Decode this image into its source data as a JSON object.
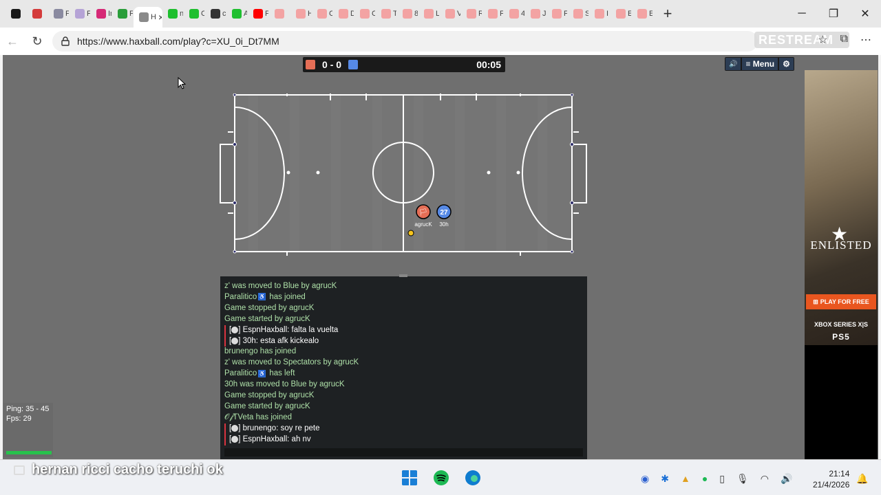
{
  "browser": {
    "tabs": [
      {
        "label": "",
        "color": "#1a1a1a"
      },
      {
        "label": "",
        "color": "#d43b3b"
      },
      {
        "label": "F",
        "color": "#8a8aa0"
      },
      {
        "label": "F",
        "color": "#b5a3d6"
      },
      {
        "label": "In",
        "color": "#d62976"
      },
      {
        "label": "F",
        "color": "#2a9d3a"
      },
      {
        "label": "n",
        "color": "#1fbf2f"
      },
      {
        "label": "C",
        "color": "#1fbf2f"
      },
      {
        "label": "c",
        "color": "#333333"
      },
      {
        "label": "A",
        "color": "#1fbf2f"
      },
      {
        "label": "P",
        "color": "#ff0000"
      },
      {
        "label": "",
        "color": "#f3a3a3"
      },
      {
        "label": "H",
        "color": "#f3a3a3"
      },
      {
        "label": "C",
        "color": "#f3a3a3"
      },
      {
        "label": "D",
        "color": "#f3a3a3"
      },
      {
        "label": "C",
        "color": "#f3a3a3"
      },
      {
        "label": "T",
        "color": "#f3a3a3"
      },
      {
        "label": "8",
        "color": "#f3a3a3"
      },
      {
        "label": "L",
        "color": "#f3a3a3"
      },
      {
        "label": "V",
        "color": "#f3a3a3"
      },
      {
        "label": "R",
        "color": "#f3a3a3"
      },
      {
        "label": "F",
        "color": "#f3a3a3"
      },
      {
        "label": "4",
        "color": "#f3a3a3"
      },
      {
        "label": "J",
        "color": "#f3a3a3"
      },
      {
        "label": "F",
        "color": "#f3a3a3"
      },
      {
        "label": "S",
        "color": "#f3a3a3"
      },
      {
        "label": "I",
        "color": "#f3a3a3"
      },
      {
        "label": "E",
        "color": "#f3a3a3"
      },
      {
        "label": "E",
        "color": "#f3a3a3"
      }
    ],
    "active_tab": {
      "label": "H",
      "close": "×"
    },
    "new_tab": "+",
    "window_controls": {
      "minimize": "─",
      "maximize": "❐",
      "close": "✕"
    },
    "back": "←",
    "reload": "↻",
    "url": "https://www.haxball.com/play?c=XU_0i_Dt7MM",
    "restream": "RESTREAM",
    "more": "⋯"
  },
  "game": {
    "score_red": "0",
    "score_sep": "-",
    "score_blue": "0",
    "time": "00:05",
    "red_color": "#e56e56",
    "blue_color": "#5689e5",
    "buttons": {
      "sound": "🔊",
      "menu": "≡ Menu",
      "settings": "⚙"
    },
    "players": [
      {
        "name": "agrucK",
        "avatar": "🏳",
        "team": "red"
      },
      {
        "name": "30h",
        "avatar": "27",
        "team": "blue"
      }
    ]
  },
  "chat": {
    "lines": [
      {
        "type": "notice",
        "text": "z' was moved to Blue by agrucK"
      },
      {
        "type": "notice",
        "text": "Paralitico",
        "badge": "♿",
        "suffix": "has joined"
      },
      {
        "type": "notice",
        "text": "Game stopped by agrucK"
      },
      {
        "type": "notice",
        "text": "Game started by agrucK"
      },
      {
        "type": "msg",
        "prefix": "[",
        "close": "] ",
        "text": "EspnHaxball: falta la vuelta"
      },
      {
        "type": "msg",
        "prefix": "[",
        "close": "] ",
        "text": "30h: esta afk kickealo"
      },
      {
        "type": "notice",
        "text": "brunengo has joined"
      },
      {
        "type": "notice",
        "text": "z' was moved to Spectators by agrucK"
      },
      {
        "type": "notice",
        "text": "Paralitico",
        "badge": "♿",
        "suffix": "has left"
      },
      {
        "type": "notice",
        "text": "30h was moved to Blue by agrucK"
      },
      {
        "type": "notice",
        "text": "Game stopped by agrucK"
      },
      {
        "type": "notice",
        "text": "Game started by agrucK"
      },
      {
        "type": "notice",
        "text": "𝒪𝒻TVeta has joined"
      },
      {
        "type": "msg",
        "prefix": "[",
        "close": "] ",
        "text": "brunengo: soy re pete"
      },
      {
        "type": "msg",
        "prefix": "[",
        "close": "] ",
        "text": "EspnHaxball: ah nv"
      }
    ]
  },
  "stats": {
    "ping": "Ping: 35 - 45",
    "fps": "Fps: 29"
  },
  "ad": {
    "logo": "ENLISTED",
    "cta": "PLAY FOR FREE",
    "xbox": "XBOX SERIES X|S",
    "ps": "PS5"
  },
  "caption": "hernan ricci cacho teruchi ok",
  "taskbar": {
    "time": "21:14",
    "date": "21/4/2026",
    "apps": [
      {
        "name": "windows-start-icon",
        "color": "#1a7fd6"
      },
      {
        "name": "spotify-icon",
        "color": "#1db954"
      },
      {
        "name": "edge-icon",
        "color": "#0f7ccf"
      }
    ]
  }
}
